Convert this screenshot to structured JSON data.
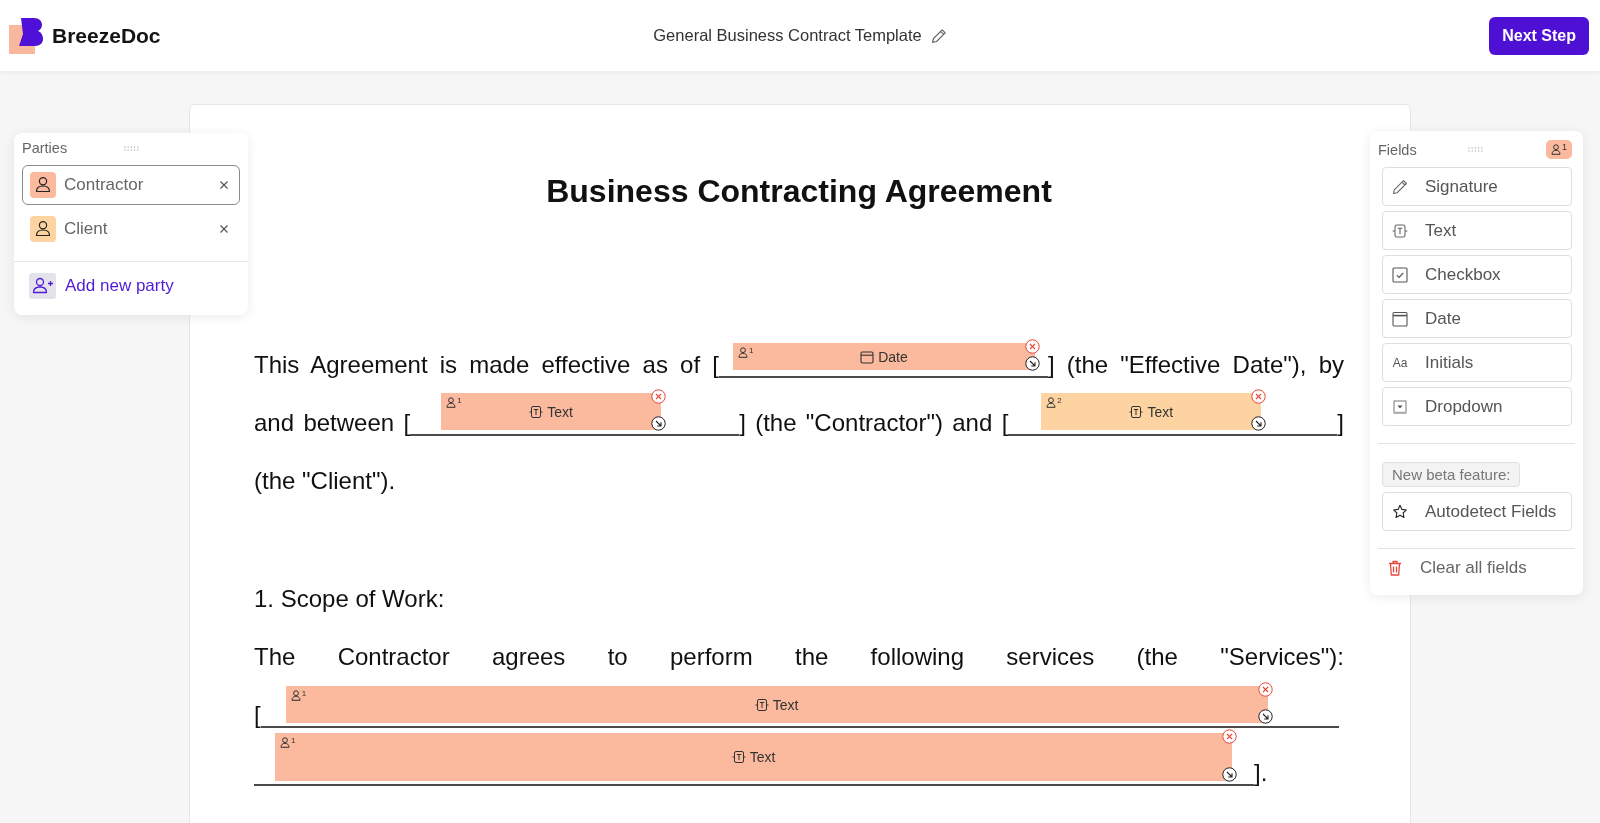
{
  "header": {
    "brand": "BreezeDoc",
    "document_title": "General Business Contract Template",
    "next_button": "Next Step"
  },
  "parties_panel": {
    "title": "Parties",
    "parties": [
      {
        "name": "Contractor",
        "color": "#fbb99d",
        "selected": true
      },
      {
        "name": "Client",
        "color": "#fdd4a1",
        "selected": false
      }
    ],
    "add_label": "Add new party"
  },
  "document": {
    "title": "Business Contracting Agreement",
    "paragraphs": [
      {
        "kind": "body",
        "lines": [
          {
            "segments": [
              {
                "kind": "text",
                "text": "This Agreement is made effective as of ["
              },
              {
                "kind": "blank",
                "field": {
                  "kind": "date",
                  "label": "Date",
                  "party": "1",
                  "color": "#fbb99d"
                }
              },
              {
                "kind": "text",
                "text": "] (the \"Effective Date\"), by"
              }
            ]
          },
          {
            "segments": [
              {
                "kind": "text",
                "text": "and between ["
              },
              {
                "kind": "blank",
                "field": {
                  "kind": "text",
                  "label": "Text",
                  "party": "1",
                  "color": "#fbb99d"
                }
              },
              {
                "kind": "text",
                "text": "] (the \"Contractor\") and ["
              },
              {
                "kind": "blank",
                "field": {
                  "kind": "text",
                  "label": "Text",
                  "party": "2",
                  "color": "#fdd4a1"
                }
              },
              {
                "kind": "text",
                "text": "]"
              }
            ]
          },
          {
            "segments": [
              {
                "kind": "text",
                "text": "(the \"Client\")."
              }
            ]
          }
        ]
      },
      {
        "kind": "heading",
        "lines": [
          {
            "segments": [
              {
                "kind": "text",
                "text": "1. Scope of Work:"
              }
            ]
          }
        ]
      },
      {
        "kind": "body",
        "lines": [
          {
            "segments": [
              {
                "kind": "text",
                "text": "The Contractor agrees to perform the following services (the \"Services\"):"
              }
            ]
          },
          {
            "segments": [
              {
                "kind": "text",
                "text": "["
              },
              {
                "kind": "blank",
                "field": {
                  "kind": "text",
                  "label": "Text",
                  "party": "1",
                  "color": "#fbb99d"
                }
              }
            ]
          },
          {
            "segments": [
              {
                "kind": "blank",
                "field": {
                  "kind": "text",
                  "label": "Text",
                  "party": "1",
                  "color": "#fbb99d"
                }
              },
              {
                "kind": "text",
                "text": "]."
              }
            ]
          }
        ]
      }
    ]
  },
  "fields_panel": {
    "title": "Fields",
    "party_badge": {
      "number": "1",
      "color": "#fbb99d"
    },
    "field_types": [
      {
        "kind": "signature",
        "label": "Signature"
      },
      {
        "kind": "text",
        "label": "Text"
      },
      {
        "kind": "checkbox",
        "label": "Checkbox"
      },
      {
        "kind": "date",
        "label": "Date"
      },
      {
        "kind": "initials",
        "label": "Initials",
        "symbol": "Aa"
      },
      {
        "kind": "dropdown",
        "label": "Dropdown"
      }
    ],
    "beta_label": "New beta feature:",
    "autodetect_label": "Autodetect Fields",
    "clear_label": "Clear all fields"
  }
}
